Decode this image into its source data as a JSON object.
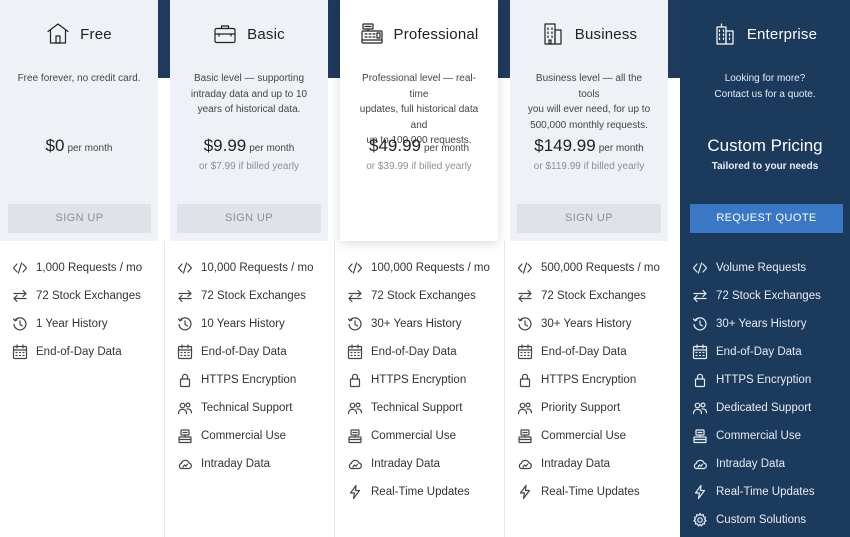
{
  "plans": [
    {
      "id": "free",
      "name": "Free",
      "icon": "house-icon",
      "description": [
        "Free forever, no credit card."
      ],
      "price": "$0",
      "per": "per month",
      "yearly": "",
      "button": "SIGN UP",
      "features": [
        {
          "icon": "code-icon",
          "label": "1,000 Requests / mo"
        },
        {
          "icon": "exchange-arrows-icon",
          "label": "72 Stock Exchanges"
        },
        {
          "icon": "history-clock-icon",
          "label": "1 Year History"
        },
        {
          "icon": "calendar-icon",
          "label": "End-of-Day Data"
        }
      ]
    },
    {
      "id": "basic",
      "name": "Basic",
      "icon": "briefcase-icon",
      "description": [
        "Basic level — supporting",
        "intraday data and up to 10",
        "years of historical data."
      ],
      "price": "$9.99",
      "per": "per month",
      "yearly": "or $7.99 if billed yearly",
      "button": "SIGN UP",
      "features": [
        {
          "icon": "code-icon",
          "label": "10,000 Requests / mo"
        },
        {
          "icon": "exchange-arrows-icon",
          "label": "72 Stock Exchanges"
        },
        {
          "icon": "history-clock-icon",
          "label": "10 Years History"
        },
        {
          "icon": "calendar-icon",
          "label": "End-of-Day Data"
        },
        {
          "icon": "lock-icon",
          "label": "HTTPS Encryption"
        },
        {
          "icon": "users-icon",
          "label": "Technical Support"
        },
        {
          "icon": "commercial-icon",
          "label": "Commercial Use"
        },
        {
          "icon": "cloud-icon",
          "label": "Intraday Data"
        }
      ]
    },
    {
      "id": "professional",
      "name": "Professional",
      "icon": "cash-register-icon",
      "description": [
        "Professional level — real-time",
        "updates, full historical data and",
        "up to 100,000 requests."
      ],
      "price": "$49.99",
      "per": "per month",
      "yearly": "or $39.99 if billed yearly",
      "button": "SIGN UP",
      "features": [
        {
          "icon": "code-icon",
          "label": "100,000 Requests / mo"
        },
        {
          "icon": "exchange-arrows-icon",
          "label": "72 Stock Exchanges"
        },
        {
          "icon": "history-clock-icon",
          "label": "30+ Years History"
        },
        {
          "icon": "calendar-icon",
          "label": "End-of-Day Data"
        },
        {
          "icon": "lock-icon",
          "label": "HTTPS Encryption"
        },
        {
          "icon": "users-icon",
          "label": "Technical Support"
        },
        {
          "icon": "commercial-icon",
          "label": "Commercial Use"
        },
        {
          "icon": "cloud-icon",
          "label": "Intraday Data"
        },
        {
          "icon": "lightning-icon",
          "label": "Real-Time Updates"
        }
      ]
    },
    {
      "id": "business",
      "name": "Business",
      "icon": "office-building-icon",
      "description": [
        "Business level — all the tools",
        "you will ever need, for up to",
        "500,000 monthly requests."
      ],
      "price": "$149.99",
      "per": "per month",
      "yearly": "or $119.99 if billed yearly",
      "button": "SIGN UP",
      "features": [
        {
          "icon": "code-icon",
          "label": "500,000 Requests / mo"
        },
        {
          "icon": "exchange-arrows-icon",
          "label": "72 Stock Exchanges"
        },
        {
          "icon": "history-clock-icon",
          "label": "30+ Years History"
        },
        {
          "icon": "calendar-icon",
          "label": "End-of-Day Data"
        },
        {
          "icon": "lock-icon",
          "label": "HTTPS Encryption"
        },
        {
          "icon": "users-icon",
          "label": "Priority Support"
        },
        {
          "icon": "commercial-icon",
          "label": "Commercial Use"
        },
        {
          "icon": "cloud-icon",
          "label": "Intraday Data"
        },
        {
          "icon": "lightning-icon",
          "label": "Real-Time Updates"
        }
      ]
    },
    {
      "id": "enterprise",
      "name": "Enterprise",
      "icon": "skyscraper-icon",
      "description": [
        "Looking for more?",
        "Contact us for a quote."
      ],
      "custom_price": "Custom Pricing",
      "tailored": "Tailored to your needs",
      "button": "REQUEST QUOTE",
      "features": [
        {
          "icon": "code-icon",
          "label": "Volume Requests"
        },
        {
          "icon": "exchange-arrows-icon",
          "label": "72 Stock Exchanges"
        },
        {
          "icon": "history-clock-icon",
          "label": "30+ Years History"
        },
        {
          "icon": "calendar-icon",
          "label": "End-of-Day Data"
        },
        {
          "icon": "lock-icon",
          "label": "HTTPS Encryption"
        },
        {
          "icon": "users-icon",
          "label": "Dedicated Support"
        },
        {
          "icon": "commercial-icon",
          "label": "Commercial Use"
        },
        {
          "icon": "cloud-icon",
          "label": "Intraday Data"
        },
        {
          "icon": "lightning-icon",
          "label": "Real-Time Updates"
        },
        {
          "icon": "gear-icon",
          "label": "Custom Solutions"
        }
      ]
    }
  ],
  "colors": {
    "navy": "#1c3a5c",
    "accent_blue": "#3a78c5",
    "card_grey": "#eef1f5",
    "disabled_button": "#dfe3e8"
  }
}
